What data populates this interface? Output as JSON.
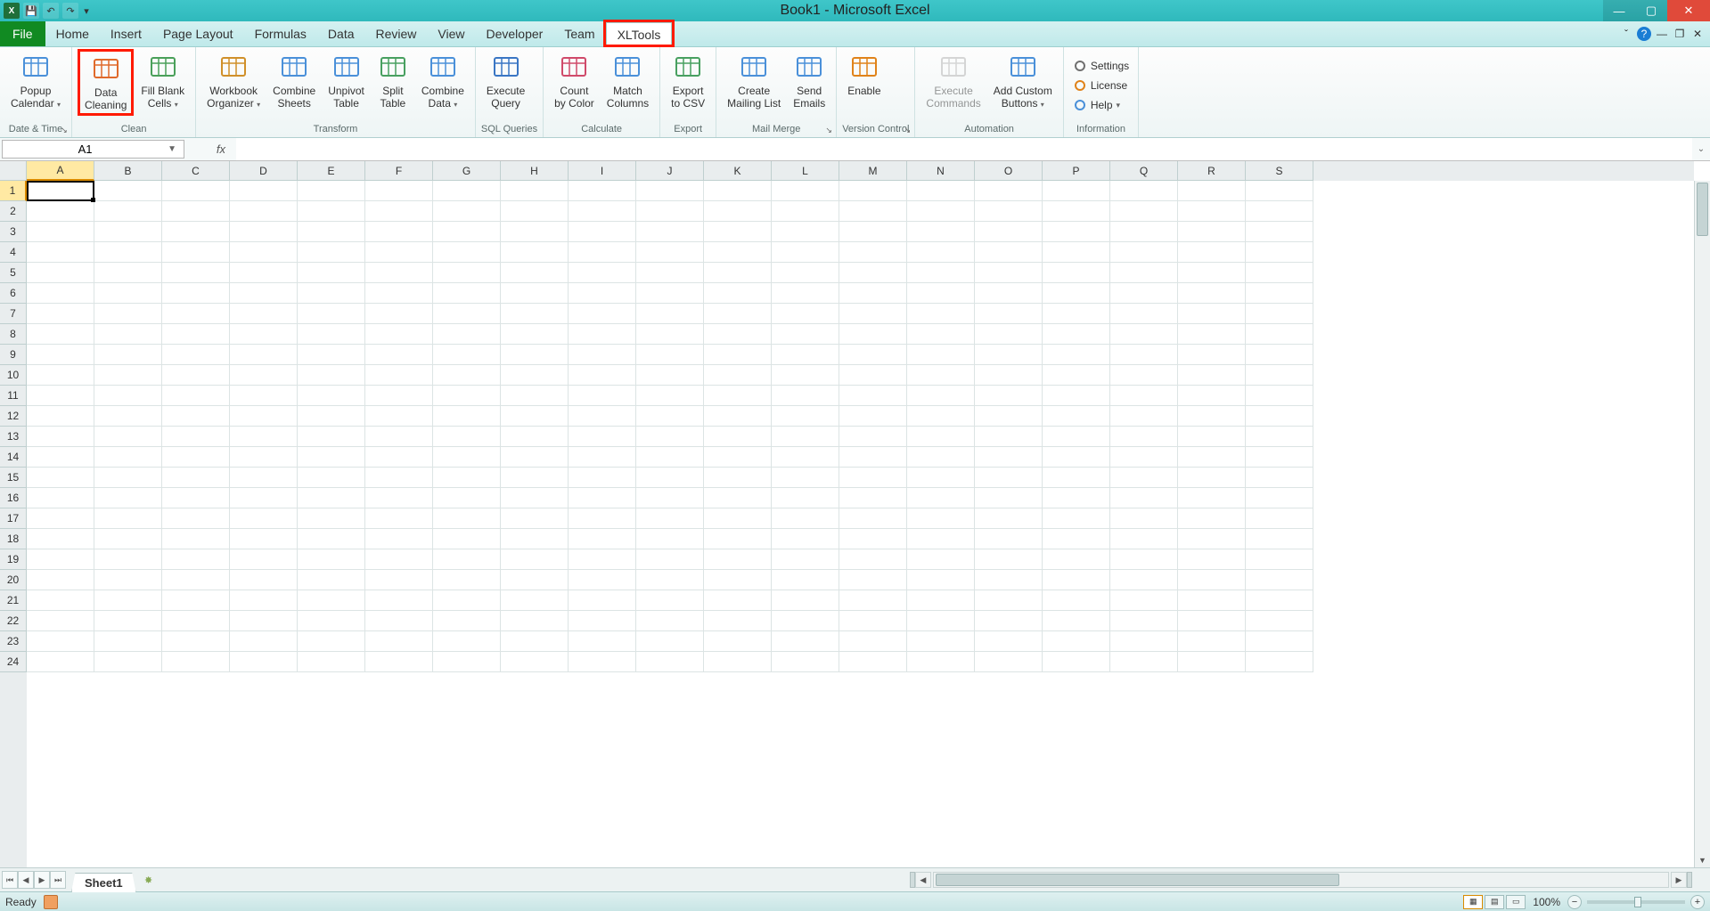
{
  "window": {
    "title": "Book1 - Microsoft Excel"
  },
  "tabs": {
    "file": "File",
    "list": [
      "Home",
      "Insert",
      "Page Layout",
      "Formulas",
      "Data",
      "Review",
      "View",
      "Developer",
      "Team",
      "XLTools"
    ],
    "active": "XLTools",
    "highlighted": "XLTools"
  },
  "ribbon": {
    "groups": [
      {
        "name": "Date & Time",
        "launcher": true,
        "buttons": [
          {
            "label": "Popup\nCalendar",
            "dd": true,
            "icon": "calendar"
          }
        ]
      },
      {
        "name": "Clean",
        "buttons": [
          {
            "label": "Data\nCleaning",
            "icon": "clean",
            "hl": true
          },
          {
            "label": "Fill Blank\nCells",
            "dd": true,
            "icon": "fill"
          }
        ]
      },
      {
        "name": "Transform",
        "buttons": [
          {
            "label": "Workbook\nOrganizer",
            "dd": true,
            "icon": "org"
          },
          {
            "label": "Combine\nSheets",
            "icon": "csheets"
          },
          {
            "label": "Unpivot\nTable",
            "icon": "unpivot"
          },
          {
            "label": "Split\nTable",
            "icon": "split"
          },
          {
            "label": "Combine\nData",
            "dd": true,
            "icon": "cdata"
          }
        ]
      },
      {
        "name": "SQL Queries",
        "buttons": [
          {
            "label": "Execute\nQuery",
            "icon": "sql"
          }
        ]
      },
      {
        "name": "Calculate",
        "buttons": [
          {
            "label": "Count\nby Color",
            "icon": "count"
          },
          {
            "label": "Match\nColumns",
            "icon": "match"
          }
        ]
      },
      {
        "name": "Export",
        "buttons": [
          {
            "label": "Export\nto CSV",
            "icon": "csv"
          }
        ]
      },
      {
        "name": "Mail Merge",
        "launcher": true,
        "buttons": [
          {
            "label": "Create\nMailing List",
            "icon": "mlist"
          },
          {
            "label": "Send\nEmails",
            "icon": "send"
          }
        ]
      },
      {
        "name": "Version Control",
        "launcher": true,
        "buttons": [
          {
            "label": "Enable",
            "icon": "clock"
          }
        ]
      },
      {
        "name": "Automation",
        "buttons": [
          {
            "label": "Execute\nCommands",
            "icon": "exec",
            "disabled": true
          },
          {
            "label": "Add Custom\nButtons",
            "dd": true,
            "icon": "addbtn"
          }
        ]
      },
      {
        "name": "Information",
        "info": true,
        "buttons": [
          {
            "label": "Settings",
            "icon": "gear"
          },
          {
            "label": "License",
            "icon": "key"
          },
          {
            "label": "Help",
            "dd": true,
            "icon": "help"
          }
        ]
      }
    ]
  },
  "name_box": {
    "value": "A1"
  },
  "formula_bar": {
    "value": "",
    "fx": "fx"
  },
  "grid": {
    "columns": [
      "A",
      "B",
      "C",
      "D",
      "E",
      "F",
      "G",
      "H",
      "I",
      "J",
      "K",
      "L",
      "M",
      "N",
      "O",
      "P",
      "Q",
      "R",
      "S"
    ],
    "rows": [
      1,
      2,
      3,
      4,
      5,
      6,
      7,
      8,
      9,
      10,
      11,
      12,
      13,
      14,
      15,
      16,
      17,
      18,
      19,
      20,
      21,
      22,
      23,
      24
    ],
    "active": "A1"
  },
  "sheets": {
    "active": "Sheet1"
  },
  "status": {
    "text": "Ready",
    "zoom": "100%"
  },
  "icons": {
    "calendar": "#4a90d9",
    "clean": "#e06a2b",
    "fill": "#4aa05a",
    "org": "#d0902a",
    "csheets": "#4a90d9",
    "unpivot": "#4a90d9",
    "split": "#48a060",
    "cdata": "#4a90d9",
    "sql": "#3a76c4",
    "count": "#d04a6a",
    "match": "#4a90d9",
    "csv": "#48a060",
    "mlist": "#4a90d9",
    "send": "#4a90d9",
    "clock": "#e0831a",
    "exec": "#b0b0b0",
    "addbtn": "#4a90d9",
    "gear": "#707070",
    "key": "#e0831a",
    "help": "#4a90d9"
  }
}
